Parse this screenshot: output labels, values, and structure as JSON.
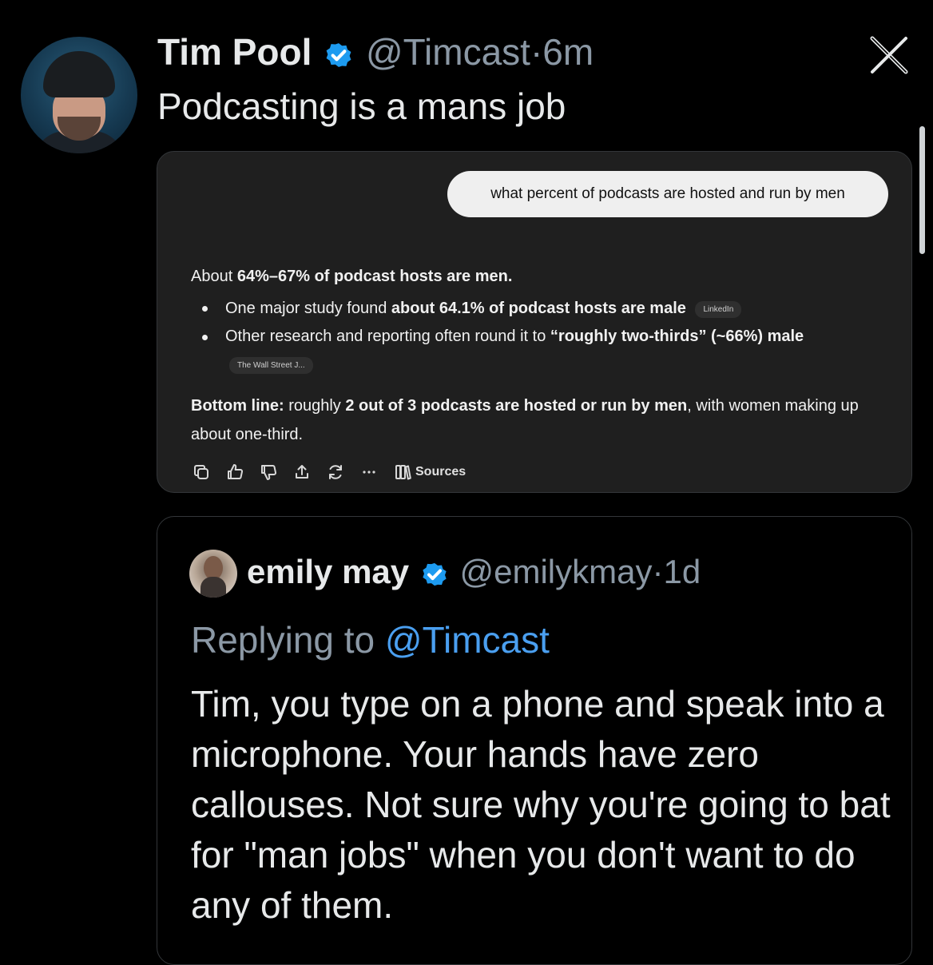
{
  "tweet": {
    "author_name": "Tim Pool",
    "handle": "@Timcast",
    "separator": "·",
    "time": "6m",
    "text": "Podcasting is a mans job"
  },
  "ai_chat": {
    "question": "what percent of podcasts are hosted and run by men",
    "summary": {
      "prefix": "About ",
      "bold": "64%–67% of podcast hosts are men."
    },
    "bullets": [
      {
        "text_pre": "One major study found ",
        "bold": "about 64.1% of podcast hosts are male",
        "text_post": "",
        "source": "LinkedIn"
      },
      {
        "text_pre": "Other research and reporting often round it to ",
        "bold": "“roughly two-thirds” (~66%) male",
        "text_post": "",
        "source": "The Wall Street J..."
      }
    ],
    "bottom_line": {
      "label": "Bottom line:",
      "text_pre": " roughly ",
      "bold": "2 out of 3 podcasts are hosted or run by men",
      "text_post": ", with women making up about one-third."
    },
    "actions": [
      "copy-icon",
      "thumbs-up-icon",
      "thumbs-down-icon",
      "share-icon",
      "regenerate-icon",
      "more-icon",
      "sources-icon"
    ],
    "sources_label": "Sources"
  },
  "quoted": {
    "author_name": "emily may",
    "handle": "@emilykmay",
    "separator": "·",
    "time": "1d",
    "replying_prefix": "Replying to ",
    "replying_to": "@Timcast",
    "text": "Tim, you type on a phone and speak into a microphone. Your hands have zero callouses. Not sure why you're going to bat for \"man jobs\" when you don't want to do any of them."
  },
  "colors": {
    "background": "#000000",
    "verified": "#1d9bf0",
    "mention": "#4a9ff0",
    "muted": "#8b98a5",
    "card": "#1f1f1f"
  }
}
